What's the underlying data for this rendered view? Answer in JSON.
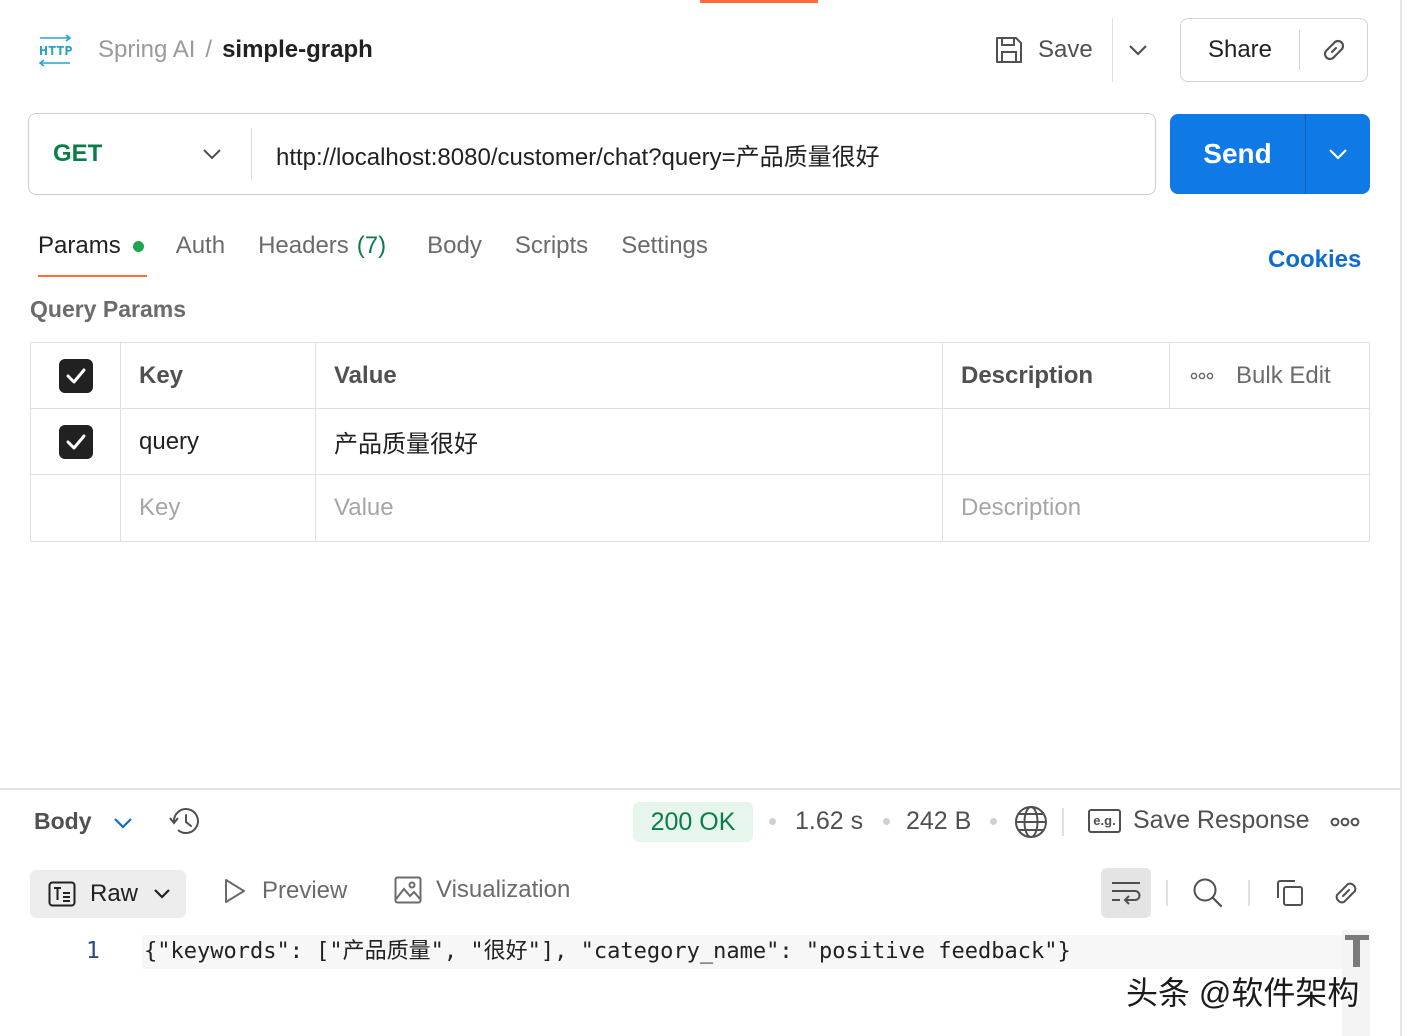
{
  "header": {
    "protocol_icon": "http-icon",
    "breadcrumb_parent": "Spring AI",
    "breadcrumb_separator": "/",
    "breadcrumb_current": "simple-graph",
    "save_label": "Save",
    "share_label": "Share"
  },
  "request": {
    "method": "GET",
    "url": "http://localhost:8080/customer/chat?query=产品质量很好",
    "send_label": "Send"
  },
  "request_tabs": {
    "params": "Params",
    "auth": "Auth",
    "headers": "Headers",
    "headers_count": "(7)",
    "body": "Body",
    "scripts": "Scripts",
    "settings": "Settings",
    "cookies": "Cookies"
  },
  "query_params": {
    "title": "Query Params",
    "columns": {
      "key": "Key",
      "value": "Value",
      "description": "Description"
    },
    "bulk_edit": "Bulk Edit",
    "rows": [
      {
        "checked": true,
        "key": "query",
        "value": "产品质量很好",
        "description": ""
      }
    ],
    "placeholders": {
      "key": "Key",
      "value": "Value",
      "description": "Description"
    }
  },
  "response": {
    "section_label": "Body",
    "status": "200 OK",
    "time": "1.62 s",
    "size": "242 B",
    "save_response": "Save Response",
    "eg_label": "e.g.",
    "format": "Raw",
    "preview": "Preview",
    "visualization": "Visualization",
    "line_number": "1",
    "body_text": "{\"keywords\": [\"产品质量\", \"很好\"], \"category_name\": \"positive feedback\"}"
  },
  "watermark": "头条 @软件架构",
  "colors": {
    "accent": "#ff6c37",
    "send_blue": "#0f7ae5",
    "method_green": "#0a7d4b",
    "status_green_bg": "#e6f6ec",
    "link_blue": "#0f6ccc"
  }
}
